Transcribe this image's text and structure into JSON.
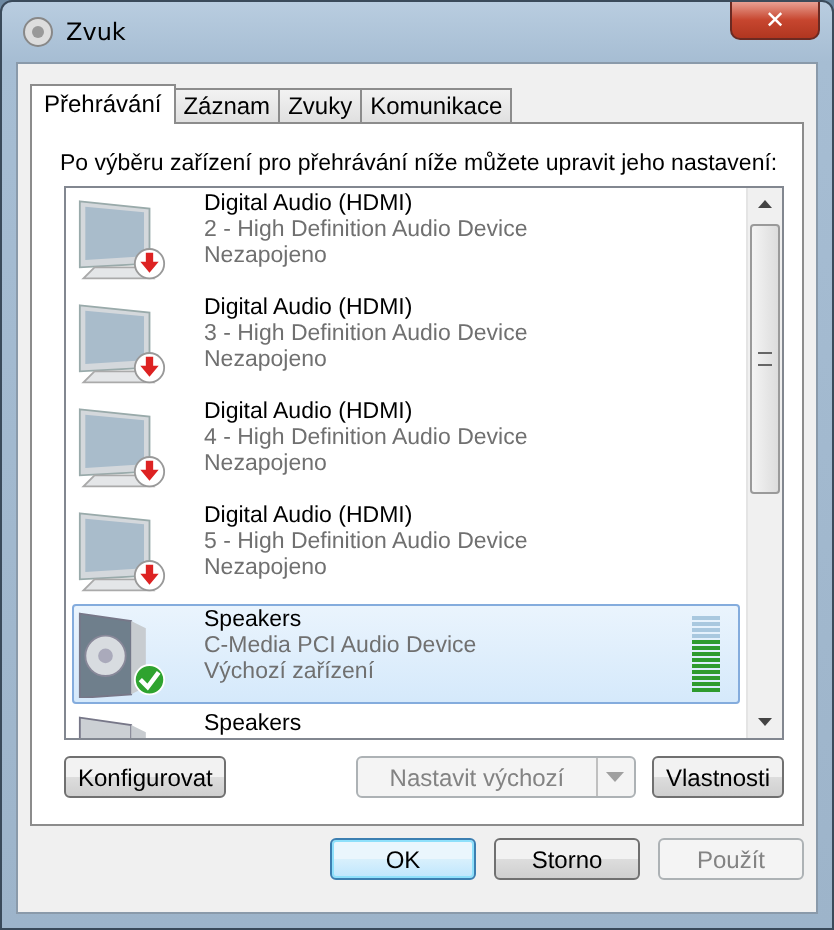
{
  "window": {
    "title": "Zvuk",
    "close": "✕"
  },
  "tabs": [
    {
      "label": "Přehrávání",
      "selected": true
    },
    {
      "label": "Záznam",
      "selected": false
    },
    {
      "label": "Zvuky",
      "selected": false
    },
    {
      "label": "Komunikace",
      "selected": false
    }
  ],
  "instruction": "Po výběru zařízení pro přehrávání níže můžete upravit jeho nastavení:",
  "devices": [
    {
      "kind": "unplugged",
      "name": "Digital Audio (HDMI)",
      "device": "2 - High Definition Audio Device",
      "status": "Nezapojeno",
      "selected": false
    },
    {
      "kind": "unplugged",
      "name": "Digital Audio (HDMI)",
      "device": "3 - High Definition Audio Device",
      "status": "Nezapojeno",
      "selected": false
    },
    {
      "kind": "unplugged",
      "name": "Digital Audio (HDMI)",
      "device": "4 - High Definition Audio Device",
      "status": "Nezapojeno",
      "selected": false
    },
    {
      "kind": "unplugged",
      "name": "Digital Audio (HDMI)",
      "device": "5 - High Definition Audio Device",
      "status": "Nezapojeno",
      "selected": false
    },
    {
      "kind": "default",
      "name": "Speakers",
      "device": "C-Media PCI Audio Device",
      "status": "Výchozí zařízení",
      "selected": true,
      "level": 0.7
    },
    {
      "kind": "speaker",
      "name": "Speakers",
      "selected": false
    }
  ],
  "panel_buttons": [
    {
      "label": "Konfigurovat",
      "disabled": false,
      "kind": "plain"
    },
    {
      "label": "Nastavit výchozí",
      "disabled": true,
      "kind": "split"
    },
    {
      "label": "Vlastnosti",
      "disabled": false,
      "kind": "plain"
    }
  ],
  "dialog_buttons": [
    {
      "label": "OK",
      "disabled": false,
      "default": true
    },
    {
      "label": "Storno",
      "disabled": false,
      "default": false
    },
    {
      "label": "Použít",
      "disabled": true,
      "default": false
    }
  ]
}
